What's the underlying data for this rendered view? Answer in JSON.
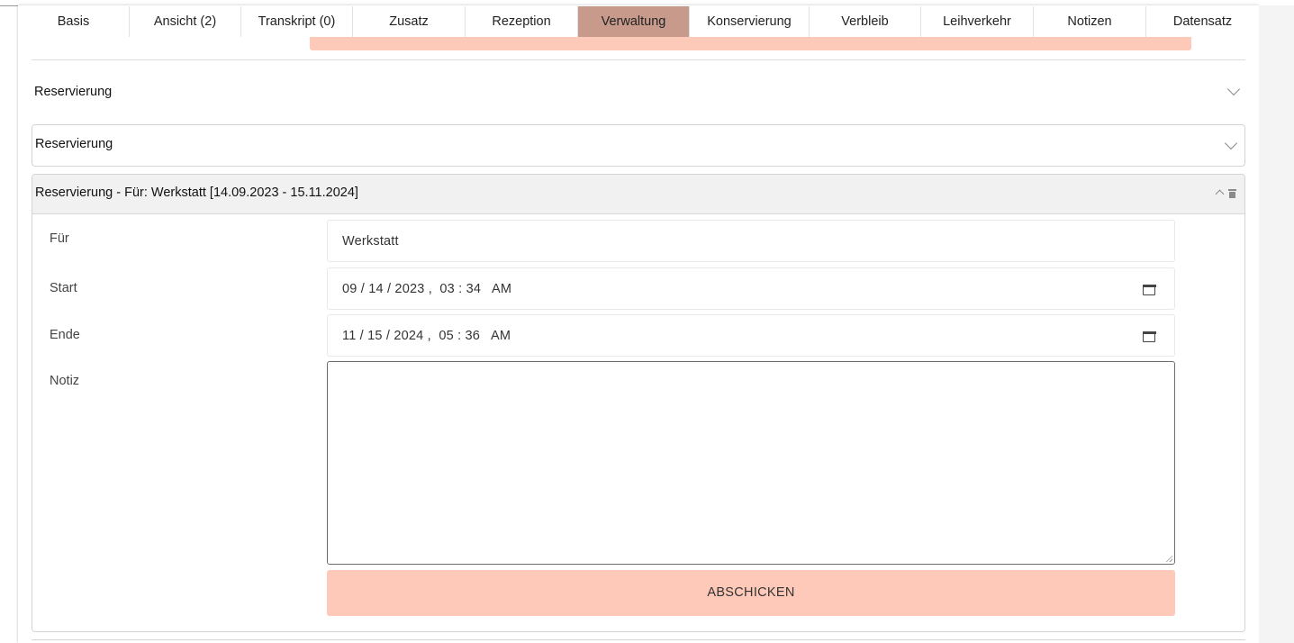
{
  "tabs": [
    {
      "label": "Basis"
    },
    {
      "label": "Ansicht (2)"
    },
    {
      "label": "Transkript (0)"
    },
    {
      "label": "Zusatz"
    },
    {
      "label": "Rezeption"
    },
    {
      "label": "Verwaltung",
      "active": true
    },
    {
      "label": "Konservierung"
    },
    {
      "label": "Verbleib"
    },
    {
      "label": "Leihverkehr"
    },
    {
      "label": "Notizen"
    },
    {
      "label": "Datensatz"
    }
  ],
  "sections": {
    "outer_title": "Reservierung",
    "first_title": "Reservierung",
    "expanded_title": "Reservierung - Für: Werkstatt [14.09.2023 - 15.11.2024]"
  },
  "form": {
    "fuer_label": "Für",
    "fuer_value": "Werkstatt",
    "start_label": "Start",
    "start_value": "09 / 14 / 2023 ,  03 : 34   AM",
    "ende_label": "Ende",
    "ende_value": "11 / 15 / 2024 ,  05 : 36   AM",
    "notiz_label": "Notiz",
    "notiz_value": "",
    "submit_label": "ABSCHICKEN"
  },
  "colors": {
    "active_tab": "#c79a8c",
    "accent_pink": "#fec9b9",
    "header_bg": "#f1f1f1"
  },
  "icons": [
    "chevron-down-icon",
    "chevron-up-icon",
    "trash-icon",
    "calendar-icon"
  ]
}
